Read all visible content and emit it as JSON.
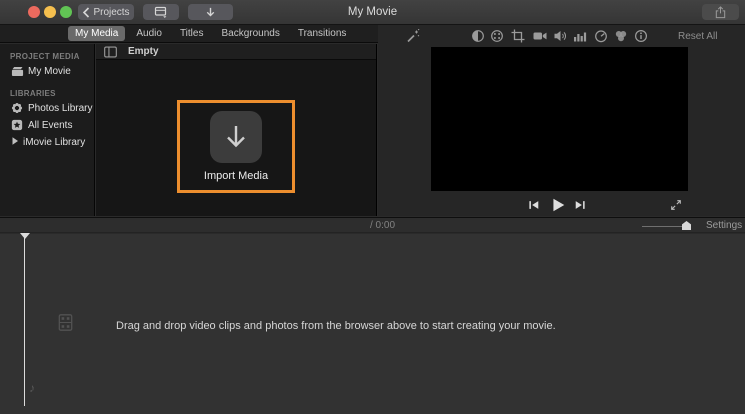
{
  "titlebar": {
    "title": "My Movie",
    "projects_label": "Projects"
  },
  "tabs": [
    {
      "label": "My Media",
      "selected": true
    },
    {
      "label": "Audio",
      "selected": false
    },
    {
      "label": "Titles",
      "selected": false
    },
    {
      "label": "Backgrounds",
      "selected": false
    },
    {
      "label": "Transitions",
      "selected": false
    }
  ],
  "sidebar": {
    "project_media_header": "PROJECT MEDIA",
    "project_items": [
      {
        "label": "My Movie",
        "icon": "clapper-icon"
      }
    ],
    "libraries_header": "LIBRARIES",
    "library_items": [
      {
        "label": "Photos Library",
        "icon": "photos-flower-icon"
      },
      {
        "label": "All Events",
        "icon": "star-square-icon"
      },
      {
        "label": "iMovie Library",
        "icon": "disclosure-triangle-icon"
      }
    ]
  },
  "browser": {
    "header": "Empty",
    "import_label": "Import Media"
  },
  "viewer": {
    "reset_all_label": "Reset All",
    "toolbar_icons": [
      "enhance-wand-icon",
      "color-balance-icon",
      "color-correction-icon",
      "crop-icon",
      "stabilization-icon",
      "volume-icon",
      "noise-equalizer-icon",
      "speed-icon",
      "clip-filter-icon",
      "clip-info-icon"
    ]
  },
  "timeline_toolbar": {
    "duration": "/ 0:00",
    "settings_label": "Settings"
  },
  "timeline": {
    "hint": "Drag and drop video clips and photos from the browser above to start creating your movie."
  },
  "colors": {
    "accent_orange": "#ED8E2E",
    "traffic_red": "#EC6A5E",
    "traffic_yellow": "#F5BF4E",
    "traffic_green": "#61C454"
  }
}
